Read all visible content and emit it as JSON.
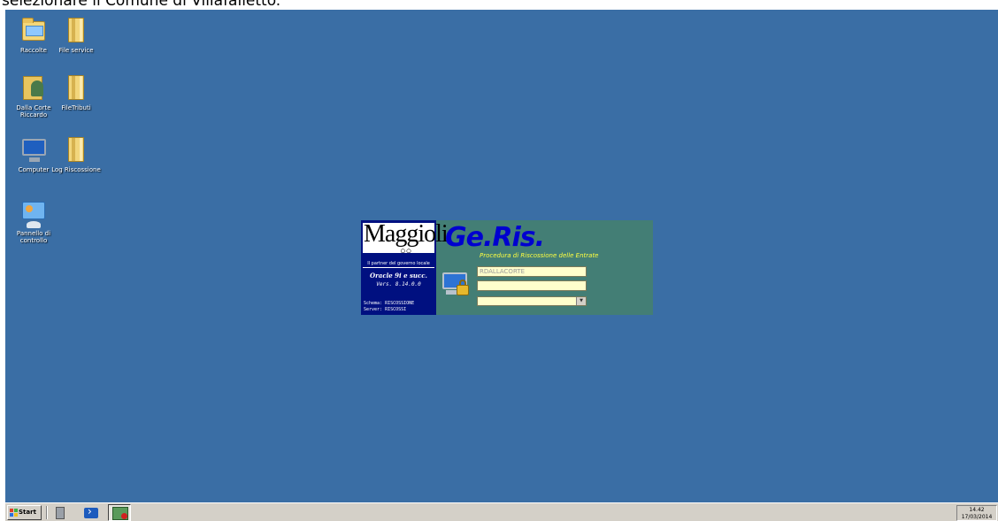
{
  "caption": "selezionare il Comune di Villafalletto.",
  "desktop": {
    "background_color": "#3a6ea5",
    "icons": [
      {
        "label": "Raccolte",
        "icon": "libraries-folder-icon"
      },
      {
        "label": "File service",
        "icon": "folder-icon"
      },
      {
        "label": "Dalla Corte Riccardo",
        "icon": "user-folder-icon"
      },
      {
        "label": "FileTributi",
        "icon": "folder-icon"
      },
      {
        "label": "Computer",
        "icon": "computer-icon"
      },
      {
        "label": "Log Riscossione",
        "icon": "folder-icon"
      },
      {
        "label": "Pannello di controllo",
        "icon": "control-panel-icon"
      }
    ]
  },
  "login": {
    "logo": "Maggioli",
    "logo_tagline": "Il partner del governo locale",
    "oracle": "Oracle 9i e succ.",
    "version": "Vers. 8.14.0.0",
    "schema": "Schema: RISCOSSIONE",
    "server": "Server: RISCOSSI",
    "app_title": "Ge.Ris.",
    "app_subtitle": "Procedura di Riscossione delle Entrate",
    "username_value": "RDALLACORTE",
    "password_value": "",
    "comune_value": "",
    "panel_color": "#437e75",
    "left_panel_color": "#001080",
    "title_color": "#0000d0"
  },
  "taskbar": {
    "start_label": "Start",
    "clock_time": "14.42",
    "clock_date": "17/03/2014"
  }
}
